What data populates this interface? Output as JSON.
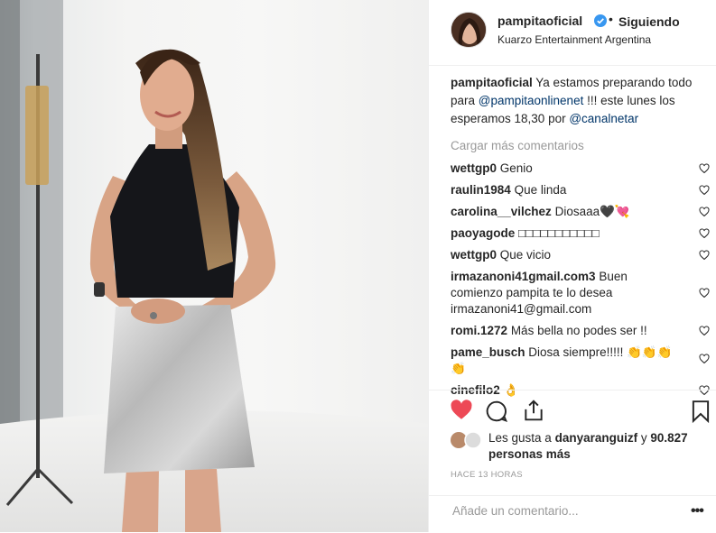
{
  "post": {
    "username": "pampitaoficial",
    "follow_status": "Siguiendo",
    "location": "Kuarzo Entertainment Argentina"
  },
  "caption": {
    "user": "pampitaoficial",
    "text_1": "Ya estamos preparando todo para",
    "mention_1": "@pampitaonlinenet",
    "text_2": "!!! este lunes los esperamos 18,30 por",
    "mention_2": "@canalnetar"
  },
  "load_more": "Cargar más comentarios",
  "comments": [
    {
      "user": "wettgp0",
      "text": "Genio"
    },
    {
      "user": "raulin1984",
      "text": "Que linda"
    },
    {
      "user": "carolina__vilchez",
      "text": "Diosaaa🖤💘"
    },
    {
      "user": "paoyagode",
      "text": "□□□□□□□□□□□"
    },
    {
      "user": "wettgp0",
      "text": "Que vicio"
    },
    {
      "user": "irmazanoni41gmail.com3",
      "text": "Buen comienzo pampita te lo desea irmazanoni41@gmail.com"
    },
    {
      "user": "romi.1272",
      "text": "Más bella no podes ser !!"
    },
    {
      "user": "pame_busch",
      "text": "Diosa siempre!!!!! 👏👏👏👏"
    },
    {
      "user": "cinefilo2",
      "text": "👌"
    }
  ],
  "likes": {
    "prefix": "Les gusta a",
    "user": "danyaranguizf",
    "middle": "y",
    "count": "90.827 personas más"
  },
  "timestamp": "HACE 13 HORAS",
  "add_comment_placeholder": "Añade un comentario...",
  "icons": {
    "like": "heart-filled-icon",
    "comment": "comment-bubble-icon",
    "share": "share-icon",
    "save": "bookmark-icon",
    "more": "more-options-icon"
  },
  "colors": {
    "like_red": "#ed4956",
    "verified_blue": "#3897f0",
    "mention": "#003569",
    "muted": "#999999"
  }
}
